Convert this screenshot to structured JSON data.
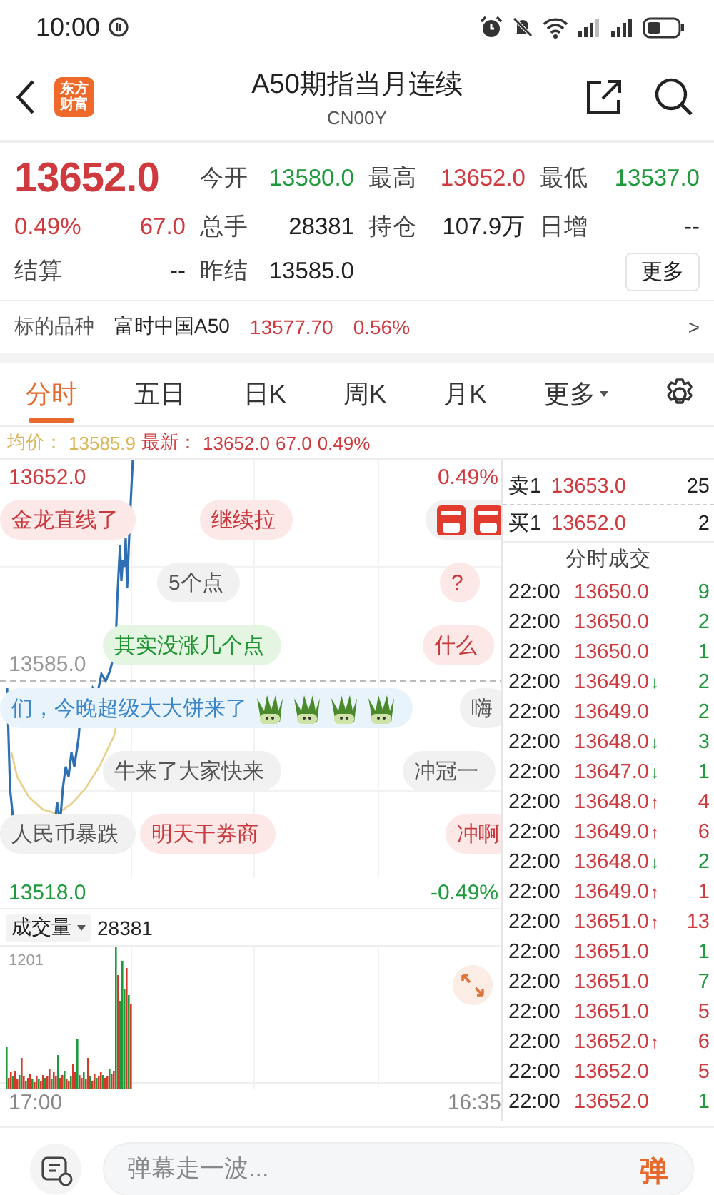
{
  "status_bar": {
    "time": "10:00"
  },
  "header": {
    "logo_text": "东方财富",
    "title": "A50期指当月连续",
    "subtitle": "CN00Y"
  },
  "quote": {
    "rows": [
      {
        "left": [
          {
            "text": "13652.0",
            "color": "#cf3a3f",
            "kind": "price"
          }
        ],
        "fields": [
          {
            "label": "今开",
            "value": "13580.0",
            "color": "#1e9a3c"
          },
          {
            "label": "最高",
            "value": "13652.0",
            "color": "#cf3a3f"
          },
          {
            "label": "最低",
            "value": "13537.0",
            "color": "#1e9a3c"
          }
        ]
      },
      {
        "left": [
          {
            "text": "0.49%",
            "color": "#cf3a3f",
            "kind": "small"
          },
          {
            "text": "67.0",
            "color": "#cf3a3f",
            "kind": "small"
          }
        ],
        "fields": [
          {
            "label": "总手",
            "value": "28381",
            "color": "#222222"
          },
          {
            "label": "持仓",
            "value": "107.9万",
            "color": "#222222"
          },
          {
            "label": "日增",
            "value": "--",
            "color": "#222222"
          }
        ]
      },
      {
        "left": [
          {
            "text": "结算",
            "color": "#444444",
            "kind": "label"
          },
          {
            "text": "--",
            "color": "#222222",
            "kind": "small"
          }
        ],
        "fields": [
          {
            "label": "昨结",
            "value": "13585.0",
            "color": "#222222"
          }
        ]
      }
    ],
    "more_button": "更多"
  },
  "underlying": {
    "label": "标的品种",
    "name": "富时中国A50",
    "price": "13577.70",
    "change_pct": "0.56%",
    "color": "#cf3a3f",
    "chevron": ">"
  },
  "tabs": [
    {
      "label": "分时",
      "selected": true,
      "kind": "tab"
    },
    {
      "label": "五日",
      "selected": false,
      "kind": "tab"
    },
    {
      "label": "日K",
      "selected": false,
      "kind": "tab"
    },
    {
      "label": "周K",
      "selected": false,
      "kind": "tab"
    },
    {
      "label": "月K",
      "selected": false,
      "kind": "tab"
    },
    {
      "label": "更多",
      "selected": false,
      "kind": "menu"
    }
  ],
  "legend": {
    "avg_label": "均价：",
    "avg_value": "13585.9",
    "last_label": "最新：",
    "last_price": "13652.0",
    "last_change": "67.0",
    "last_pct": "0.49%"
  },
  "chart": {
    "high_price": "13652.0",
    "high_pct": "0.49%",
    "base_price": "13585.0",
    "low_price": "13518.0",
    "low_pct": "-0.49%",
    "volume_label": "成交量",
    "volume_total": "28381",
    "volume_max": "1201",
    "time_start": "17:00",
    "time_end": "16:35"
  },
  "danmaku": [
    {
      "text": "金龙直线了",
      "kind": "hot"
    },
    {
      "text": "继续拉",
      "kind": "hot"
    },
    {
      "kind": "plain",
      "stickers": [
        {
          "kind": "badge"
        },
        {
          "kind": "badge"
        }
      ]
    },
    {
      "text": "5个点",
      "kind": "plain"
    },
    {
      "text": "?",
      "kind": "hot"
    },
    {
      "text": "其实没涨几个点",
      "kind": "green"
    },
    {
      "text": "什么",
      "kind": "hot"
    },
    {
      "text": "们，今晚超级大大饼来了",
      "kind": "blue",
      "stickers": [
        {
          "kind": "leek"
        },
        {
          "kind": "leek"
        },
        {
          "kind": "leek"
        },
        {
          "kind": "leek"
        }
      ]
    },
    {
      "text": "嗨",
      "kind": "plain"
    },
    {
      "text": "牛来了大家快来",
      "kind": "plain"
    },
    {
      "text": "冲冠一",
      "kind": "plain"
    },
    {
      "text": "人民币暴跌",
      "kind": "plain"
    },
    {
      "text": "明天干券商",
      "kind": "hot"
    },
    {
      "text": "冲啊",
      "kind": "hot"
    }
  ],
  "order_book": [
    {
      "side_label": "卖1",
      "price": "13653.0",
      "volume": "25"
    },
    {
      "side_label": "买1",
      "price": "13652.0",
      "volume": "2"
    }
  ],
  "trades_title": "分时成交",
  "trades": [
    {
      "time": "22:00",
      "price": "13650.0",
      "volume": "9",
      "color": "#1e9a3c"
    },
    {
      "time": "22:00",
      "price": "13650.0",
      "volume": "2",
      "color": "#1e9a3c"
    },
    {
      "time": "22:00",
      "price": "13650.0",
      "volume": "1",
      "color": "#1e9a3c"
    },
    {
      "time": "22:00",
      "price": "13649.0",
      "arrow": {
        "text": "↓",
        "color": "#1e9a3c"
      },
      "volume": "2",
      "color": "#1e9a3c"
    },
    {
      "time": "22:00",
      "price": "13649.0",
      "volume": "2",
      "color": "#1e9a3c"
    },
    {
      "time": "22:00",
      "price": "13648.0",
      "arrow": {
        "text": "↓",
        "color": "#1e9a3c"
      },
      "volume": "3",
      "color": "#1e9a3c"
    },
    {
      "time": "22:00",
      "price": "13647.0",
      "arrow": {
        "text": "↓",
        "color": "#1e9a3c"
      },
      "volume": "1",
      "color": "#1e9a3c"
    },
    {
      "time": "22:00",
      "price": "13648.0",
      "arrow": {
        "text": "↑",
        "color": "#cf3a3f"
      },
      "volume": "4",
      "color": "#cf3a3f"
    },
    {
      "time": "22:00",
      "price": "13649.0",
      "arrow": {
        "text": "↑",
        "color": "#cf3a3f"
      },
      "volume": "6",
      "color": "#cf3a3f"
    },
    {
      "time": "22:00",
      "price": "13648.0",
      "arrow": {
        "text": "↓",
        "color": "#1e9a3c"
      },
      "volume": "2",
      "color": "#1e9a3c"
    },
    {
      "time": "22:00",
      "price": "13649.0",
      "arrow": {
        "text": "↑",
        "color": "#cf3a3f"
      },
      "volume": "1",
      "color": "#cf3a3f"
    },
    {
      "time": "22:00",
      "price": "13651.0",
      "arrow": {
        "text": "↑",
        "color": "#cf3a3f"
      },
      "volume": "13",
      "color": "#cf3a3f"
    },
    {
      "time": "22:00",
      "price": "13651.0",
      "volume": "1",
      "color": "#1e9a3c"
    },
    {
      "time": "22:00",
      "price": "13651.0",
      "volume": "7",
      "color": "#1e9a3c"
    },
    {
      "time": "22:00",
      "price": "13651.0",
      "volume": "5",
      "color": "#cf3a3f"
    },
    {
      "time": "22:00",
      "price": "13652.0",
      "arrow": {
        "text": "↑",
        "color": "#cf3a3f"
      },
      "volume": "6",
      "color": "#cf3a3f"
    },
    {
      "time": "22:00",
      "price": "13652.0",
      "volume": "5",
      "color": "#cf3a3f"
    },
    {
      "time": "22:00",
      "price": "13652.0",
      "volume": "1",
      "color": "#1e9a3c"
    }
  ],
  "comment": {
    "placeholder": "弹幕走一波...",
    "send_label": "弹"
  }
}
